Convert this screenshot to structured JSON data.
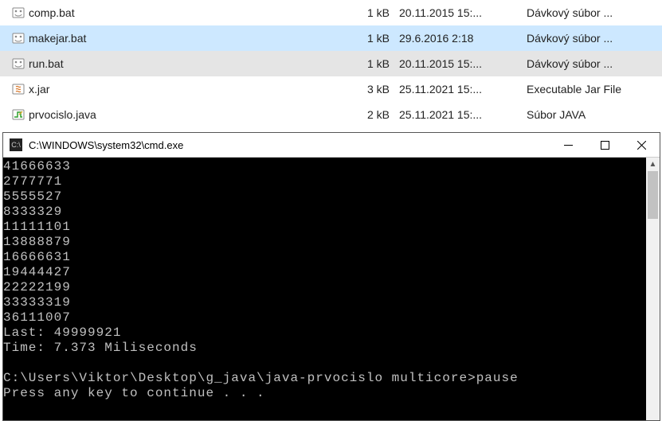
{
  "files": [
    {
      "name": "comp.bat",
      "size": "1 kB",
      "date": "20.11.2015 15:...",
      "type": "Dávkový súbor ...",
      "icon": "bat",
      "state": ""
    },
    {
      "name": "makejar.bat",
      "size": "1 kB",
      "date": "29.6.2016 2:18",
      "type": "Dávkový súbor ...",
      "icon": "bat",
      "state": "sel"
    },
    {
      "name": "run.bat",
      "size": "1 kB",
      "date": "20.11.2015 15:...",
      "type": "Dávkový súbor ...",
      "icon": "bat",
      "state": "hov"
    },
    {
      "name": "x.jar",
      "size": "3 kB",
      "date": "25.11.2021 15:...",
      "type": "Executable Jar File",
      "icon": "jar",
      "state": ""
    },
    {
      "name": "prvocislo.java",
      "size": "2 kB",
      "date": "25.11.2021 15:...",
      "type": "Súbor JAVA",
      "icon": "java",
      "state": ""
    }
  ],
  "cmd": {
    "title": "C:\\WINDOWS\\system32\\cmd.exe",
    "lines": [
      "41666633",
      "2777771",
      "5555527",
      "8333329",
      "11111101",
      "13888879",
      "16666631",
      "19444427",
      "22222199",
      "33333319",
      "36111007",
      "Last: 49999921",
      "Time: 7.373 Miliseconds",
      "",
      "C:\\Users\\Viktor\\Desktop\\g_java\\java-prvocislo multicore>pause",
      "Press any key to continue . . ."
    ]
  }
}
